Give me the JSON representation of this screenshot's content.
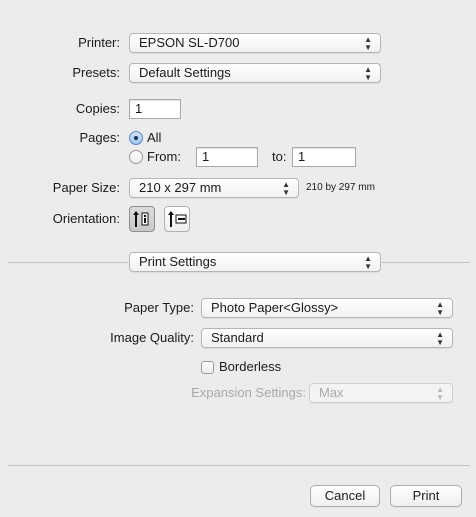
{
  "printer": {
    "label": "Printer:",
    "value": "EPSON SL-D700"
  },
  "presets": {
    "label": "Presets:",
    "value": "Default Settings"
  },
  "copies": {
    "label": "Copies:",
    "value": "1"
  },
  "pages": {
    "label": "Pages:",
    "all_label": "All",
    "from_label": "From:",
    "from_value": "1",
    "to_label": "to:",
    "to_value": "1",
    "selected": "all"
  },
  "paper_size": {
    "label": "Paper Size:",
    "value": "210 x 297 mm",
    "description": "210 by 297 mm"
  },
  "orientation": {
    "label": "Orientation:",
    "options": [
      "portrait",
      "landscape"
    ],
    "selected": "portrait"
  },
  "section_menu": {
    "value": "Print Settings"
  },
  "paper_type": {
    "label": "Paper Type:",
    "value": "Photo Paper<Glossy>"
  },
  "image_quality": {
    "label": "Image Quality:",
    "value": "Standard"
  },
  "borderless": {
    "label": "Borderless",
    "checked": false
  },
  "expansion": {
    "label": "Expansion Settings:",
    "value": "Max",
    "enabled": false
  },
  "buttons": {
    "cancel": "Cancel",
    "print": "Print"
  },
  "icons": {
    "popup_arrows": "up-down-chevron-icon"
  }
}
